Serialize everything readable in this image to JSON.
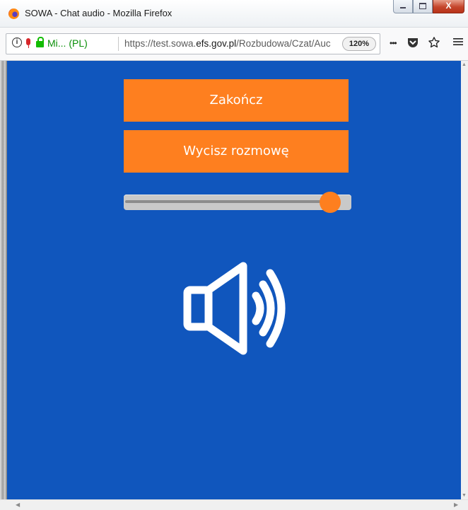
{
  "window": {
    "title": "SOWA - Chat audio - Mozilla Firefox",
    "buttons": {
      "minimize": "",
      "maximize": "",
      "close": "X"
    }
  },
  "addressbar": {
    "site_owner": "Mi... (PL)",
    "url_prefix": "https://test.sowa.",
    "url_domain": "efs.gov.pl",
    "url_rest": "/Rozbudowa/Czat/Auc",
    "zoom": "120%",
    "more_label": "•••"
  },
  "icons": {
    "info": "info-icon",
    "mic": "microphone-icon",
    "lock": "lock-icon",
    "pocket": "pocket-icon",
    "bookmark": "star-icon",
    "menu": "hamburger-menu-icon",
    "speaker": "speaker-volume-icon"
  },
  "main": {
    "end_button_label": "Zakończ",
    "mute_button_label": "Wycisz rozmowę",
    "volume_level": 0.95
  },
  "colors": {
    "page_background": "#1056bd",
    "accent": "#fe7f1f",
    "text_on_accent": "#ffffff"
  }
}
